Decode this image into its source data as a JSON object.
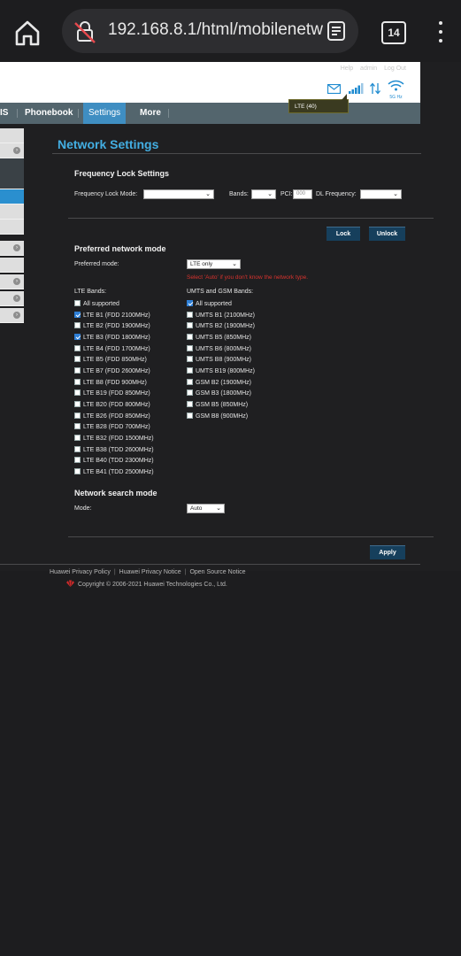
{
  "browser": {
    "url": "192.168.8.1/html/mobilenetw",
    "tab_count": "14"
  },
  "header": {
    "links": [
      "Help",
      "admin",
      "Log Out"
    ],
    "wifi_label": "5G Hz",
    "tooltip": "LTE (40)"
  },
  "nav": {
    "items": [
      "IS",
      "Phonebook",
      "Settings",
      "More"
    ],
    "active": "Settings"
  },
  "page": {
    "title": "Network Settings",
    "freq_lock": {
      "heading": "Frequency Lock Settings",
      "mode_label": "Frequency Lock Mode:",
      "mode_value": "",
      "bands_label": "Bands:",
      "bands_value": "",
      "pci_label": "PCI:",
      "pci_placeholder": "000",
      "dl_label": "DL Frequency:",
      "dl_value": "",
      "lock_button": "Lock",
      "unlock_button": "Unlock"
    },
    "preferred": {
      "heading": "Preferred network mode",
      "mode_label": "Preferred mode:",
      "mode_value": "LTE only",
      "warning": "Select 'Auto' if you don't know the network type.",
      "lte_heading": "LTE Bands:",
      "umts_heading": "UMTS and GSM Bands:",
      "lte_bands": [
        {
          "label": "All supported",
          "checked": false
        },
        {
          "label": "LTE B1 (FDD 2100MHz)",
          "checked": true
        },
        {
          "label": "LTE B2 (FDD 1900MHz)",
          "checked": false
        },
        {
          "label": "LTE B3 (FDD 1800MHz)",
          "checked": true
        },
        {
          "label": "LTE B4 (FDD 1700MHz)",
          "checked": false
        },
        {
          "label": "LTE B5 (FDD 850MHz)",
          "checked": false
        },
        {
          "label": "LTE B7 (FDD 2600MHz)",
          "checked": false
        },
        {
          "label": "LTE B8 (FDD 900MHz)",
          "checked": false
        },
        {
          "label": "LTE B19 (FDD 850MHz)",
          "checked": false
        },
        {
          "label": "LTE B20 (FDD 800MHz)",
          "checked": false
        },
        {
          "label": "LTE B26 (FDD 850MHz)",
          "checked": false
        },
        {
          "label": "LTE B28 (FDD 700MHz)",
          "checked": false
        },
        {
          "label": "LTE B32 (FDD 1500MHz)",
          "checked": false
        },
        {
          "label": "LTE B38 (TDD 2600MHz)",
          "checked": false
        },
        {
          "label": "LTE B40 (TDD 2300MHz)",
          "checked": false
        },
        {
          "label": "LTE B41 (TDD 2500MHz)",
          "checked": false
        }
      ],
      "umts_bands": [
        {
          "label": "All supported",
          "checked": true
        },
        {
          "label": "UMTS B1 (2100MHz)",
          "checked": false
        },
        {
          "label": "UMTS B2 (1900MHz)",
          "checked": false
        },
        {
          "label": "UMTS B5 (850MHz)",
          "checked": false
        },
        {
          "label": "UMTS B6 (800MHz)",
          "checked": false
        },
        {
          "label": "UMTS B8 (900MHz)",
          "checked": false
        },
        {
          "label": "UMTS B19 (800MHz)",
          "checked": false
        },
        {
          "label": "GSM B2 (1900MHz)",
          "checked": false
        },
        {
          "label": "GSM B3 (1800MHz)",
          "checked": false
        },
        {
          "label": "GSM B5 (850MHz)",
          "checked": false
        },
        {
          "label": "GSM B8 (900MHz)",
          "checked": false
        }
      ]
    },
    "search": {
      "heading": "Network search mode",
      "mode_label": "Mode:",
      "mode_value": "Auto",
      "apply_button": "Apply"
    }
  },
  "footer": {
    "links": [
      "Huawei Privacy Policy",
      "Huawei Privacy Notice",
      "Open Source Notice"
    ],
    "copyright": "Copyright © 2006-2021 Huawei Technologies Co., Ltd."
  },
  "colors": {
    "accent": "#43aee2",
    "nav_active": "#3f8ec2",
    "warning": "#d8332e",
    "button": "#163f5c"
  }
}
